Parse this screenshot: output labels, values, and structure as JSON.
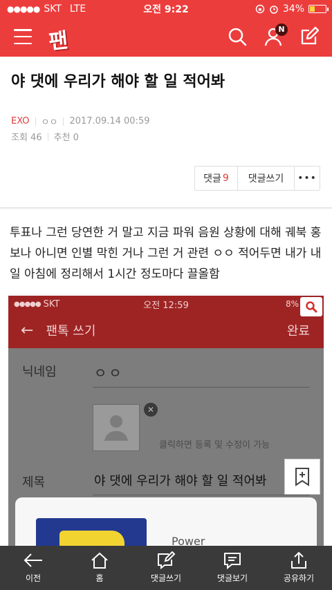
{
  "status_bar": {
    "carrier": "SKT",
    "network": "LTE",
    "time": "오전 9:22",
    "battery_percent": "34%",
    "battery_level": 0.34
  },
  "app": {
    "logo_text": "팬",
    "notification_badge": "N",
    "accent_color": "#ec3d3d"
  },
  "post": {
    "title": "야 댓에 우리가 해야 할 일 적어봐",
    "category": "EXO",
    "author": "ㅇㅇ",
    "datetime": "2017.09.14 00:59",
    "views_label": "조회 46",
    "recommend_label": "추천 0",
    "comments_label": "댓글",
    "comments_count": "9",
    "write_comment_label": "댓글쓰기",
    "more_label": "•••",
    "body": "투표나 그런 당연한 거 말고 지금 파워 음원 상황에 대해 궤북 홍보나 아니면 인별 막힌 거나 그런 거 관련 ㅇㅇ 적어두면 내가 내일 아침에 정리해서 1시간 정도마다 끌올함"
  },
  "embedded_screenshot": {
    "carrier": "SKT",
    "time": "오전 12:59",
    "battery_percent": "8%",
    "header_title": "팬톡 쓰기",
    "done_label": "완료",
    "nickname_label": "닉네임",
    "nickname_value": "ㅇㅇ",
    "image_hint": "클릭하면 등록 및 수정이 가능",
    "title_label": "제목",
    "title_value": "야 댓에 우리가 해야 할 일 적어봐",
    "card_text": "Power"
  },
  "bottom_nav": [
    {
      "label": "이전",
      "icon": "back-arrow-icon"
    },
    {
      "label": "홈",
      "icon": "home-icon"
    },
    {
      "label": "댓글쓰기",
      "icon": "write-comment-icon"
    },
    {
      "label": "댓글보기",
      "icon": "view-comments-icon"
    },
    {
      "label": "공유하기",
      "icon": "share-icon"
    }
  ]
}
